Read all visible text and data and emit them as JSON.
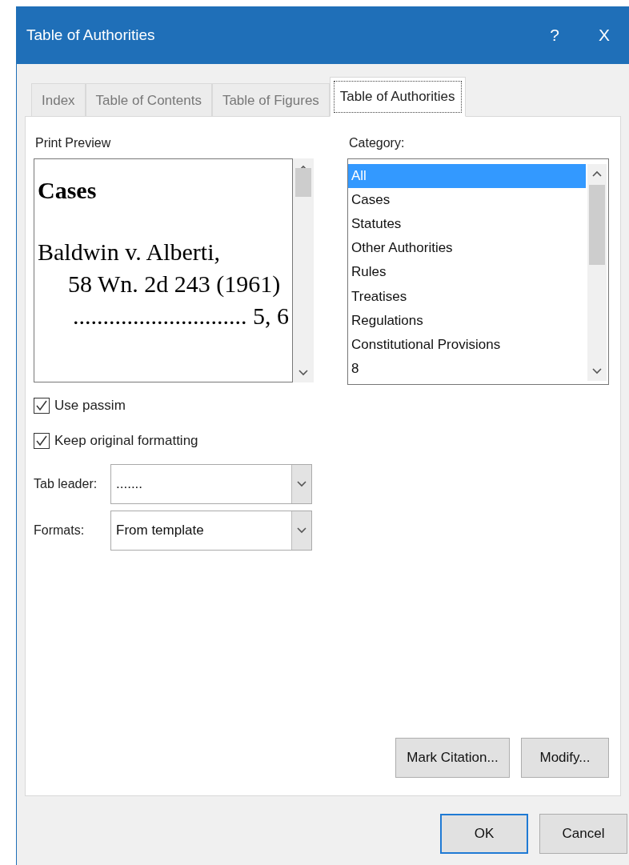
{
  "window": {
    "title": "Table of Authorities",
    "help": "?",
    "close": "X"
  },
  "tabs": [
    {
      "label": "Index",
      "selected": false
    },
    {
      "label": "Table of Contents",
      "selected": false
    },
    {
      "label": "Table of Figures",
      "selected": false
    },
    {
      "label": "Table of Authorities",
      "selected": true
    }
  ],
  "preview": {
    "label": "Print Preview",
    "heading": "Cases",
    "lines": [
      {
        "text": "Baldwin v. Alberti,",
        "kind": "entry"
      },
      {
        "text": "58 Wn. 2d 243 (1961)",
        "kind": "continuation"
      },
      {
        "text": "............................. 5, 6",
        "kind": "leader"
      }
    ]
  },
  "category": {
    "label": "Category:",
    "items": [
      {
        "label": "All",
        "selected": true
      },
      {
        "label": "Cases",
        "selected": false
      },
      {
        "label": "Statutes",
        "selected": false
      },
      {
        "label": "Other Authorities",
        "selected": false
      },
      {
        "label": "Rules",
        "selected": false
      },
      {
        "label": "Treatises",
        "selected": false
      },
      {
        "label": "Regulations",
        "selected": false
      },
      {
        "label": "Constitutional Provisions",
        "selected": false
      },
      {
        "label": "8",
        "selected": false
      }
    ]
  },
  "options": [
    {
      "label": "Use passim",
      "checked": true
    },
    {
      "label": "Keep original formatting",
      "checked": true
    }
  ],
  "dropdowns": [
    {
      "label": "Tab leader:",
      "value": "......."
    },
    {
      "label": "Formats:",
      "value": "From template"
    }
  ],
  "panel_buttons": [
    "Mark Citation...",
    "Modify..."
  ],
  "dialog_buttons": [
    {
      "label": "OK",
      "default": true
    },
    {
      "label": "Cancel",
      "default": false
    }
  ]
}
